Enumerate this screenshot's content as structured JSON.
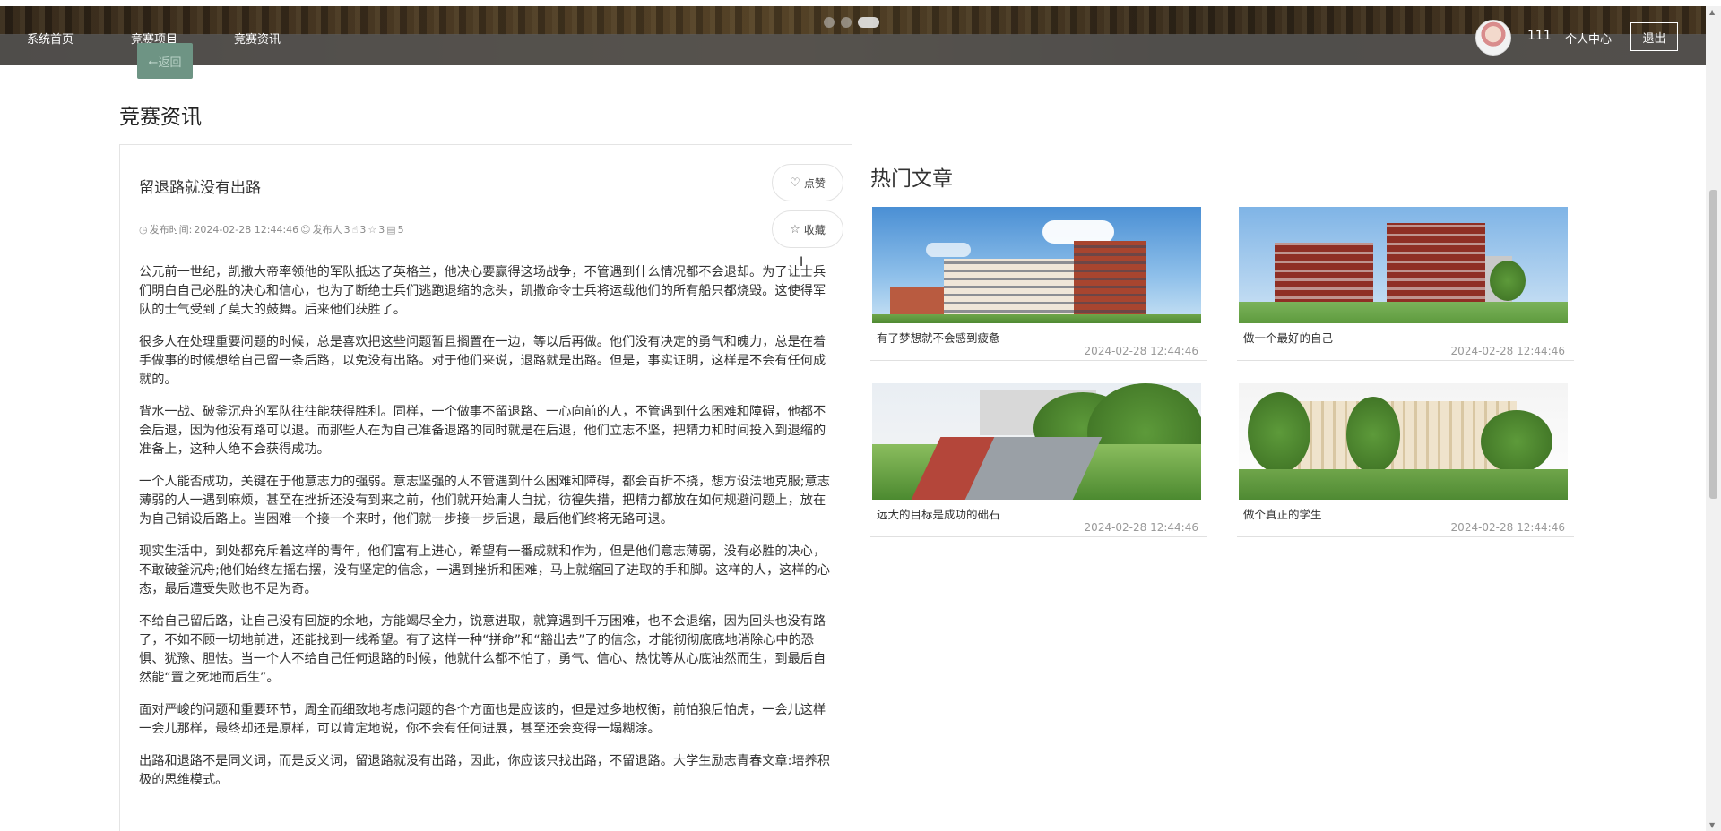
{
  "nav": {
    "home": "系统首页",
    "projects": "竞赛项目",
    "news": "竞赛资讯",
    "back": "←返回",
    "username": "111",
    "personal_center": "个人中心",
    "logout": "退出"
  },
  "page": {
    "title": "竞赛资讯"
  },
  "article": {
    "title": "留退路就没有出路",
    "publish_label": "发布时间:",
    "publish_time": "2024-02-28 12:44:46",
    "publisher_label": "发布人",
    "publisher": "3",
    "likes": "3",
    "favorites": "3",
    "comments": "5",
    "like_label": "点赞",
    "favorite_label": "收藏",
    "paragraphs": [
      "公元前一世纪，凯撒大帝率领他的军队抵达了英格兰，他决心要赢得这场战争，不管遇到什么情况都不会退却。为了让士兵们明白自己必胜的决心和信心，也为了断绝士兵们逃跑退缩的念头，凯撒命令士兵将运载他们的所有船只都烧毁。这使得军队的士气受到了莫大的鼓舞。后来他们获胜了。",
      "很多人在处理重要问题的时候，总是喜欢把这些问题暂且搁置在一边，等以后再做。他们没有决定的勇气和魄力，总是在着手做事的时候想给自己留一条后路，以免没有出路。对于他们来说，退路就是出路。但是，事实证明，这样是不会有任何成就的。",
      "背水一战、破釜沉舟的军队往往能获得胜利。同样，一个做事不留退路、一心向前的人，不管遇到什么困难和障碍，他都不会后退，因为他没有路可以退。而那些人在为自己准备退路的同时就是在后退，他们立志不坚，把精力和时间投入到退缩的准备上，这种人绝不会获得成功。",
      "一个人能否成功，关键在于他意志力的强弱。意志坚强的人不管遇到什么困难和障碍，都会百折不挠，想方设法地克服;意志薄弱的人一遇到麻烦，甚至在挫折还没有到来之前，他们就开始庸人自扰，彷徨失措，把精力都放在如何规避问题上，放在为自己铺设后路上。当困难一个接一个来时，他们就一步接一步后退，最后他们终将无路可退。",
      "现实生活中，到处都充斥着这样的青年，他们富有上进心，希望有一番成就和作为，但是他们意志薄弱，没有必胜的决心，不敢破釜沉舟;他们始终左摇右摆，没有坚定的信念，一遇到挫折和困难，马上就缩回了进取的手和脚。这样的人，这样的心态，最后遭受失败也不足为奇。",
      "不给自己留后路，让自己没有回旋的余地，方能竭尽全力，锐意进取，就算遇到千万困难，也不会退缩，因为回头也没有路了，不如不顾一切地前进，还能找到一线希望。有了这样一种“拼命”和“豁出去”了的信念，才能彻彻底底地消除心中的恐惧、犹豫、胆怯。当一个人不给自己任何退路的时候，他就什么都不怕了，勇气、信心、热忱等从心底油然而生，到最后自然能“置之死地而后生”。",
      "面对严峻的问题和重要环节，周全而细致地考虑问题的各个方面也是应该的，但是过多地权衡，前怕狼后怕虎，一会儿这样一会儿那样，最终却还是原样，可以肯定地说，你不会有任何进展，甚至还会变得一塌糊涂。",
      "出路和退路不是同义词，而是反义词，留退路就没有出路，因此，你应该只找出路，不留退路。大学生励志青春文章:培养积极的思维模式。"
    ]
  },
  "hot": {
    "title": "热门文章",
    "cards": [
      {
        "title": "有了梦想就不会感到疲惫",
        "date": "2024-02-28 12:44:46"
      },
      {
        "title": "做一个最好的自己",
        "date": "2024-02-28 12:44:46"
      },
      {
        "title": "远大的目标是成功的础石",
        "date": "2024-02-28 12:44:46"
      },
      {
        "title": "做个真正的学生",
        "date": "2024-02-28 12:44:46"
      }
    ]
  },
  "icons": {
    "clock": "clock-icon",
    "user": "user-icon",
    "like": "thumb-icon",
    "star": "star-icon",
    "comment": "comment-icon",
    "heart": "heart-icon"
  },
  "colors": {
    "back_button": "#6e9484",
    "nav_overlay": "#5a5a5a"
  }
}
